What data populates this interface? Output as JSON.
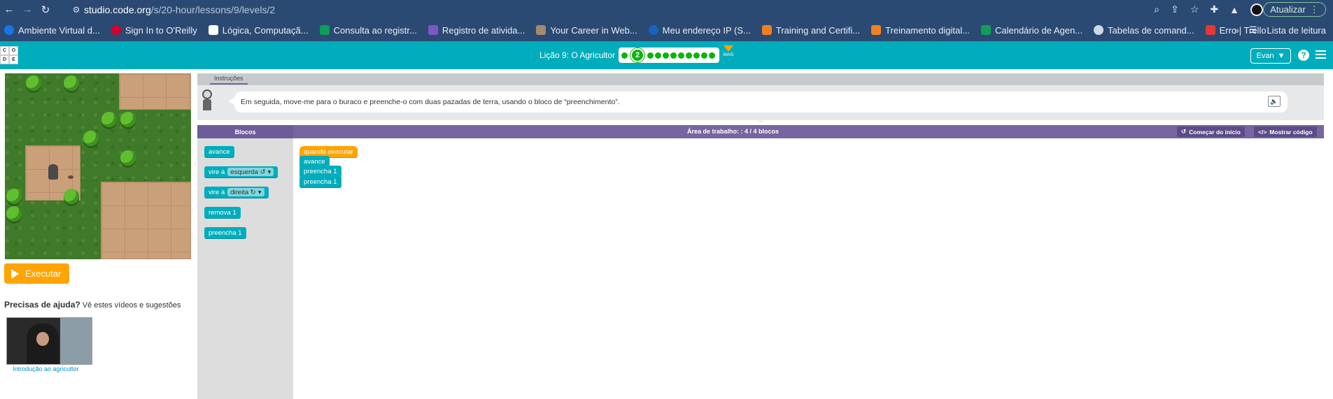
{
  "browser": {
    "url_host": "studio.code.org",
    "url_path": "/s/20-hour/lessons/9/levels/2",
    "update_label": "Atualizar"
  },
  "bookmarks": [
    {
      "label": "Ambiente Virtual d...",
      "color": "#1a73e8"
    },
    {
      "label": "Sign In to O'Reilly",
      "color": "#d3002d"
    },
    {
      "label": "Lógica, Computaçã...",
      "color": "#ffffff"
    },
    {
      "label": "Consulta ao registr...",
      "color": "#0f9d58"
    },
    {
      "label": "Registro de ativida...",
      "color": "#7e57c2"
    },
    {
      "label": "Your Career in Web...",
      "color": "#a38b6f"
    },
    {
      "label": "Meu endereço IP (S...",
      "color": "#1565c0"
    },
    {
      "label": "Training and Certifi...",
      "color": "#f38020"
    },
    {
      "label": "Treinamento digital...",
      "color": "#f38020"
    },
    {
      "label": "Calendário de Agen...",
      "color": "#0f9d58"
    },
    {
      "label": "Tabelas de comand...",
      "color": "#cfd8e3"
    },
    {
      "label": "Erro | Trello",
      "color": "#e53935"
    }
  ],
  "bookmarks_more": "»",
  "reading_list": "Lista de leitura",
  "header": {
    "logo_letters": [
      "C",
      "O",
      "D",
      "E"
    ],
    "lesson_title": "Lição 9: O Agricultor",
    "current_level": "2",
    "more_label": "MAIS",
    "user_name": "Evan"
  },
  "game": {
    "run_label": "Executar"
  },
  "help": {
    "title": "Precisas de ajuda?",
    "subtitle": "Vê estes vídeos e sugestões",
    "video_caption": "Introdução ao agricultor"
  },
  "instructions": {
    "tab_label": "Instruções",
    "text": "Em seguida, move-me para o buraco e preenche-o com duas pazadas de terra, usando o bloco de “preenchimento”."
  },
  "workspace": {
    "toolbox_title": "Blocos",
    "area_title": "Área de trabalho: : 4 / 4 blocos",
    "start_over_label": "Começar do início",
    "show_code_label": "Mostrar código",
    "toolbox_blocks": [
      {
        "label": "avance"
      },
      {
        "label": "vire à",
        "dropdown": "esquerda ↺"
      },
      {
        "label": "vire à",
        "dropdown": "direita ↻"
      },
      {
        "label": "remova 1"
      },
      {
        "label": "preencha 1"
      }
    ],
    "program_blocks": [
      {
        "label": "quando executar",
        "type": "event"
      },
      {
        "label": "avance"
      },
      {
        "label": "preencha 1"
      },
      {
        "label": "preencha 1"
      }
    ]
  },
  "colors": {
    "brand_teal": "#00adbc",
    "workspace_purple": "#7665a0",
    "run_orange": "#ffa400",
    "progress_green": "#0cb30c"
  }
}
